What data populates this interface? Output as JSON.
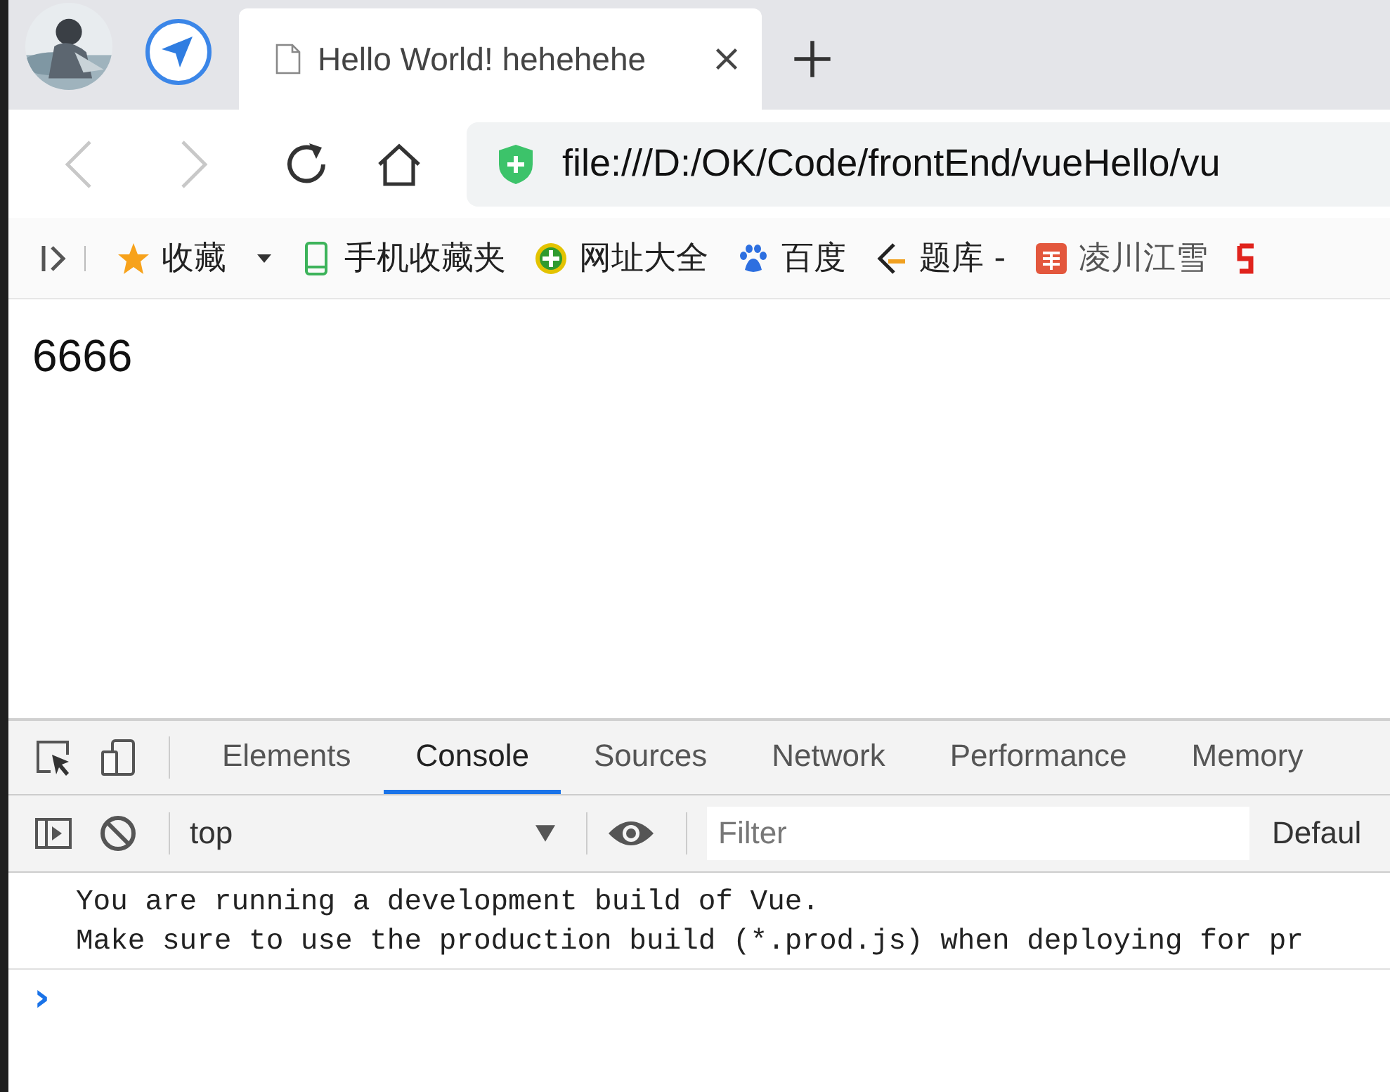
{
  "tabs": [
    {
      "title": "Hello World! hehehehe",
      "selected": true
    }
  ],
  "nav": {
    "back_disabled": true,
    "forward_disabled": true
  },
  "address": "file:///D:/OK/Code/frontEnd/vueHello/vu",
  "bookmarks": [
    {
      "kind": "star",
      "label": "收藏",
      "dropdown": true
    },
    {
      "kind": "phone",
      "label": "手机收藏夹",
      "dropdown": false
    },
    {
      "kind": "plus",
      "label": "网址大全",
      "dropdown": false
    },
    {
      "kind": "paw",
      "label": "百度",
      "dropdown": false
    },
    {
      "kind": "bracket",
      "label": "题库 -",
      "dropdown": false
    },
    {
      "kind": "square",
      "label": "凌川江雪",
      "dropdown": false
    },
    {
      "kind": "edge",
      "dropdown": false
    }
  ],
  "page_text": "6666",
  "devtools": {
    "tabs": [
      {
        "label": "Elements",
        "selected": false
      },
      {
        "label": "Console",
        "selected": true
      },
      {
        "label": "Sources",
        "selected": false
      },
      {
        "label": "Network",
        "selected": false
      },
      {
        "label": "Performance",
        "selected": false
      },
      {
        "label": "Memory",
        "selected": false
      }
    ],
    "context": "top",
    "filter": {
      "placeholder": "Filter"
    },
    "levels": "Defaul",
    "messages": [
      "You are running a development build of Vue.",
      "Make sure to use the production build (*.prod.js) when deploying for pr"
    ],
    "prompt": "›"
  }
}
